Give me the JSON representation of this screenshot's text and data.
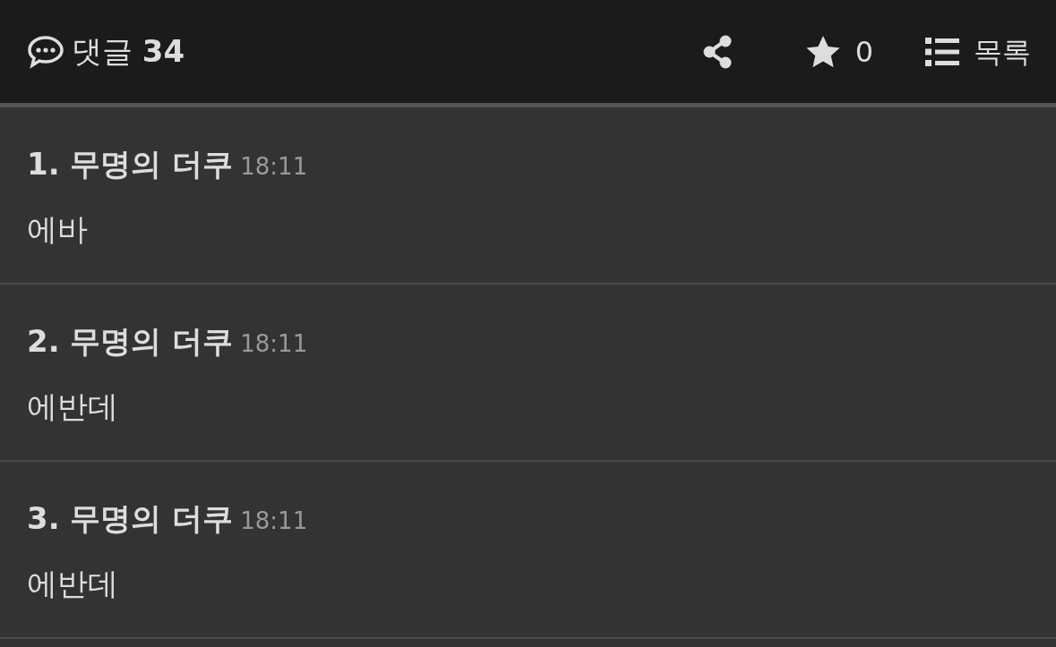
{
  "header": {
    "title": "댓글 **34**",
    "star_count": "0",
    "list_label": "목록"
  },
  "comments": [
    {
      "author": "1. 무명의 더쿠",
      "time": "18:11",
      "text": "에바"
    },
    {
      "author": "2. 무명의 더쿠",
      "time": "18:11",
      "text": "에반데"
    },
    {
      "author": "3. 무명의 더쿠",
      "time": "18:11",
      "text": "에반데"
    }
  ]
}
